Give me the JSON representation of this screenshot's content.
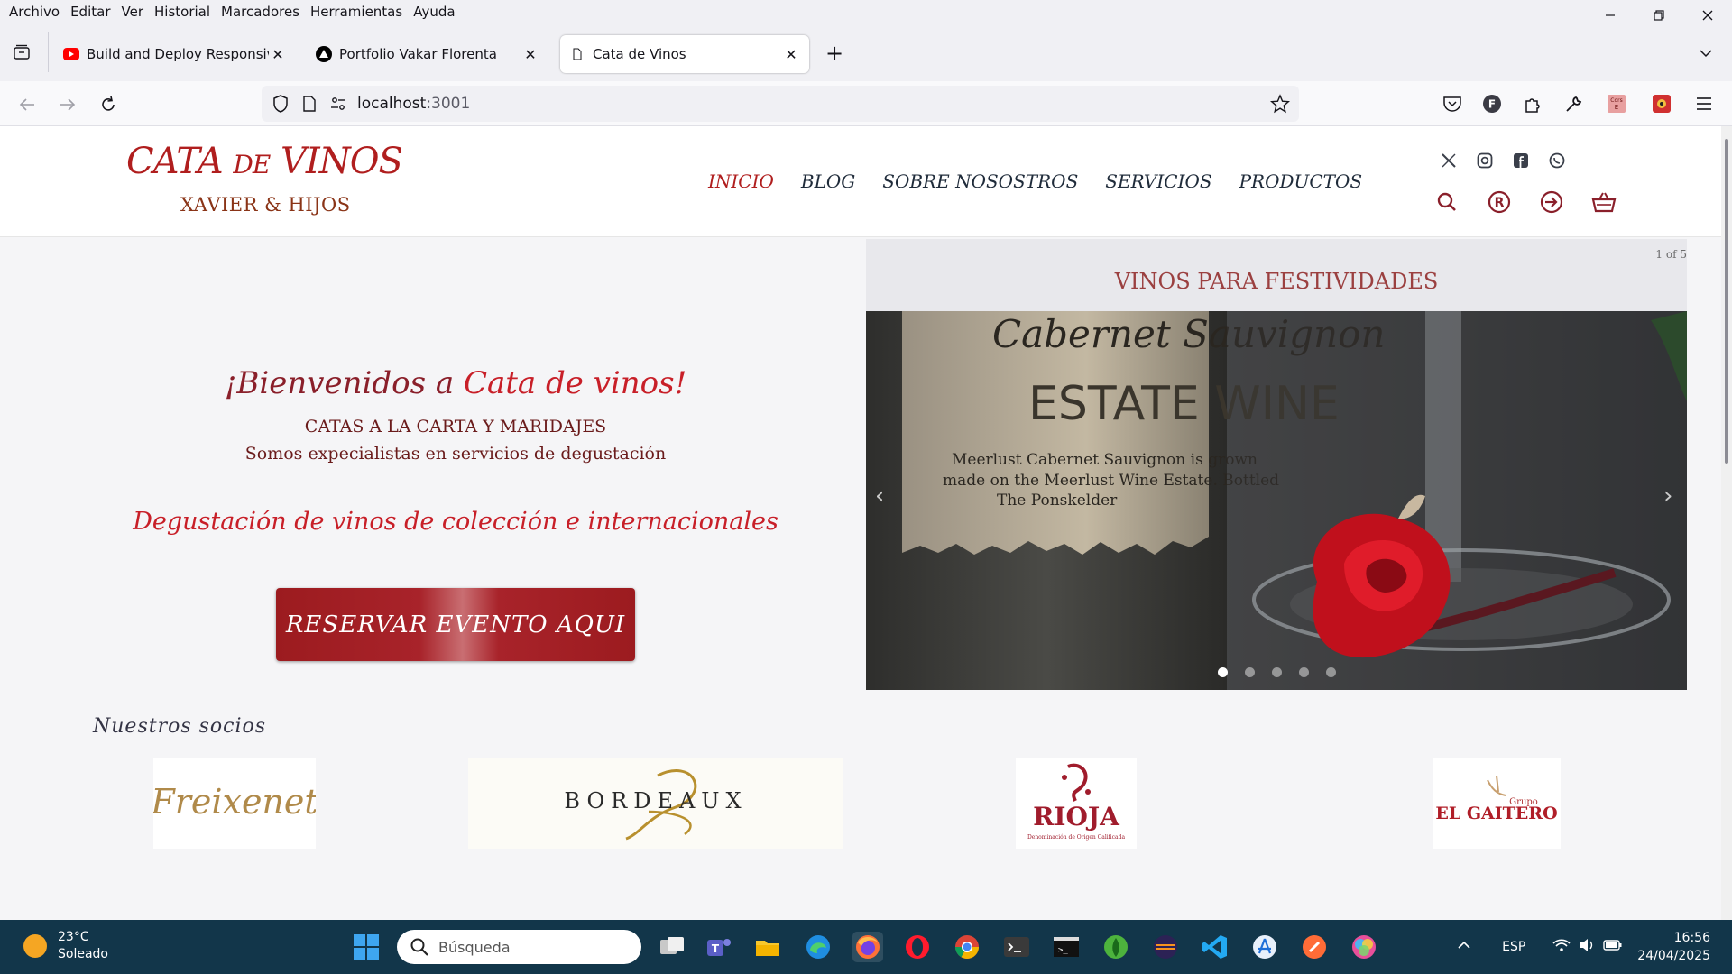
{
  "menu": [
    "Archivo",
    "Editar",
    "Ver",
    "Historial",
    "Marcadores",
    "Herramientas",
    "Ayuda"
  ],
  "tabs": [
    {
      "title": "Build and Deploy Responsive Re",
      "icon": "youtube-icon"
    },
    {
      "title": "Portfolio Vakar Florenta",
      "icon": "triangle-icon"
    },
    {
      "title": "Cata de Vinos",
      "icon": "page-icon"
    }
  ],
  "url": {
    "host": "localhost",
    "port": ":3001"
  },
  "site": {
    "logo_main_1": "CATA ",
    "logo_main_small": "DE",
    "logo_main_2": " VINOS",
    "logo_sub": "XAVIER & HIJOS",
    "nav": [
      "INICIO",
      "BLOG",
      "SOBRE NOSOSTROS",
      "SERVICIOS",
      "PRODUCTOS"
    ],
    "welcome_1": "¡Bienvenidos a ",
    "welcome_2": "Cata de vinos!",
    "subtitle_1": "CATAS A LA CARTA Y MARIDAJES",
    "subtitle_2": "Somos expecialistas en servicios de degustación",
    "tagline": "Degustación de vinos de colección e internacionales",
    "cta": "RESERVAR EVENTO AQUI",
    "carousel": {
      "counter": "1 of 5",
      "title": "VINOS PARA FESTIVIDADES",
      "total": 5,
      "current": 1,
      "label_line1": "Cabernet Sauvignon",
      "label_line2": "ESTATE WINE",
      "label_line3": "Meerlust Cabernet Sauvignon is grown",
      "label_line4": "made on the Meerlust Wine Estate. Bottled",
      "label_line5": "The Ponskelder"
    },
    "partners_title": "Nuestros socios",
    "partners": [
      {
        "name": "Freixenet"
      },
      {
        "name": "BORDEAUX"
      },
      {
        "name": "RIOJA",
        "sub": "Denominación de Origen Calificada"
      },
      {
        "name": "EL GAITERO",
        "sub": "Grupo"
      }
    ]
  },
  "taskbar": {
    "temp": "23°C",
    "weather": "Soleado",
    "search_placeholder": "Búsqueda",
    "lang": "ESP",
    "time": "16:56",
    "date": "24/04/2025"
  },
  "colors": {
    "brand_red": "#b01e1e",
    "cta_red": "#9c1b1f",
    "taskbar": "#12364a"
  }
}
